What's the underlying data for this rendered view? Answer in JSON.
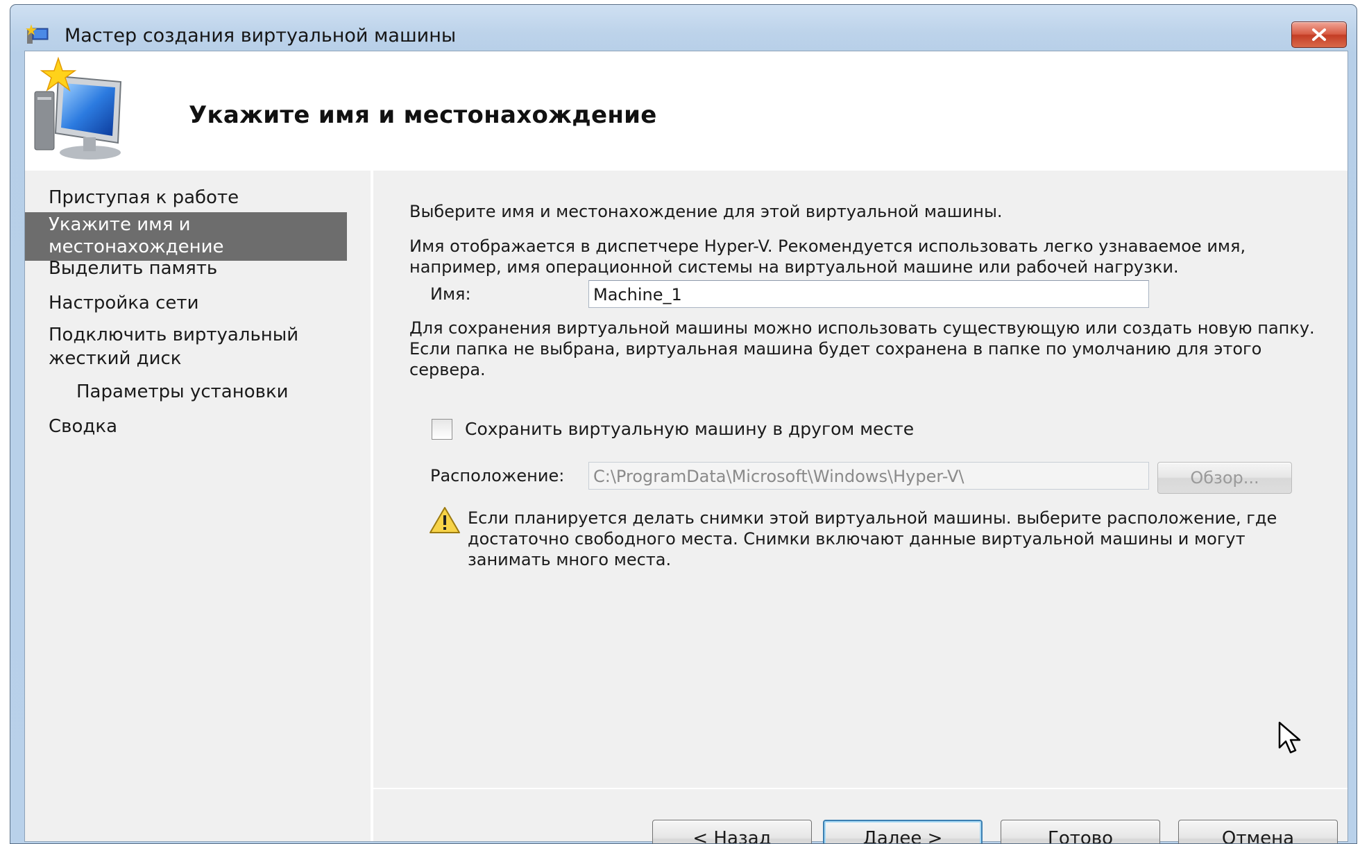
{
  "window": {
    "title": "Мастер создания виртуальной машины"
  },
  "icons": {
    "app": "hyper-v-wizard-icon",
    "close": "close-icon",
    "header": "computer-wizard-icon",
    "warning": "warning-icon",
    "cursor": "mouse-pointer-icon"
  },
  "header": {
    "title": "Укажите имя и местонахождение"
  },
  "nav": {
    "items": [
      {
        "label": "Приступая к работе"
      },
      {
        "label": "Укажите имя и местонахождение"
      },
      {
        "label": "Выделить память"
      },
      {
        "label": "Настройка сети"
      },
      {
        "label": "Подключить виртуальный жесткий диск"
      },
      {
        "label": "Параметры установки"
      },
      {
        "label": "Сводка"
      }
    ]
  },
  "content": {
    "intro": "Выберите имя и местонахождение для этой виртуальной машины.",
    "name_hint": "Имя отображается в диспетчере Hyper-V. Рекомендуется использовать легко узнаваемое имя, например, имя операционной системы на виртуальной машине или рабочей нагрузки.",
    "name_label": "Имя:",
    "name_value": "Machine_1",
    "folder_hint": "Для сохранения виртуальной машины можно использовать существующую или создать новую папку. Если папка не выбрана, виртуальная машина будет сохранена в папке по умолчанию для этого сервера.",
    "store_elsewhere_label": "Сохранить виртуальную машину в другом месте",
    "location_label": "Расположение:",
    "location_value": "C:\\ProgramData\\Microsoft\\Windows\\Hyper-V\\",
    "browse_label": "Обзор...",
    "warning_text": "Если планируется делать снимки этой виртуальной машины. выберите расположение, где достаточно свободного места. Снимки включают данные виртуальной машины и могут занимать много места."
  },
  "buttons": {
    "back": "< Назад",
    "next": "Далее >",
    "finish": "Готово",
    "cancel": "Отмена"
  },
  "colors": {
    "nav_selected": "#6d6d6d",
    "close_button": "#c33d25",
    "title_bar": "#bdd3ea"
  }
}
